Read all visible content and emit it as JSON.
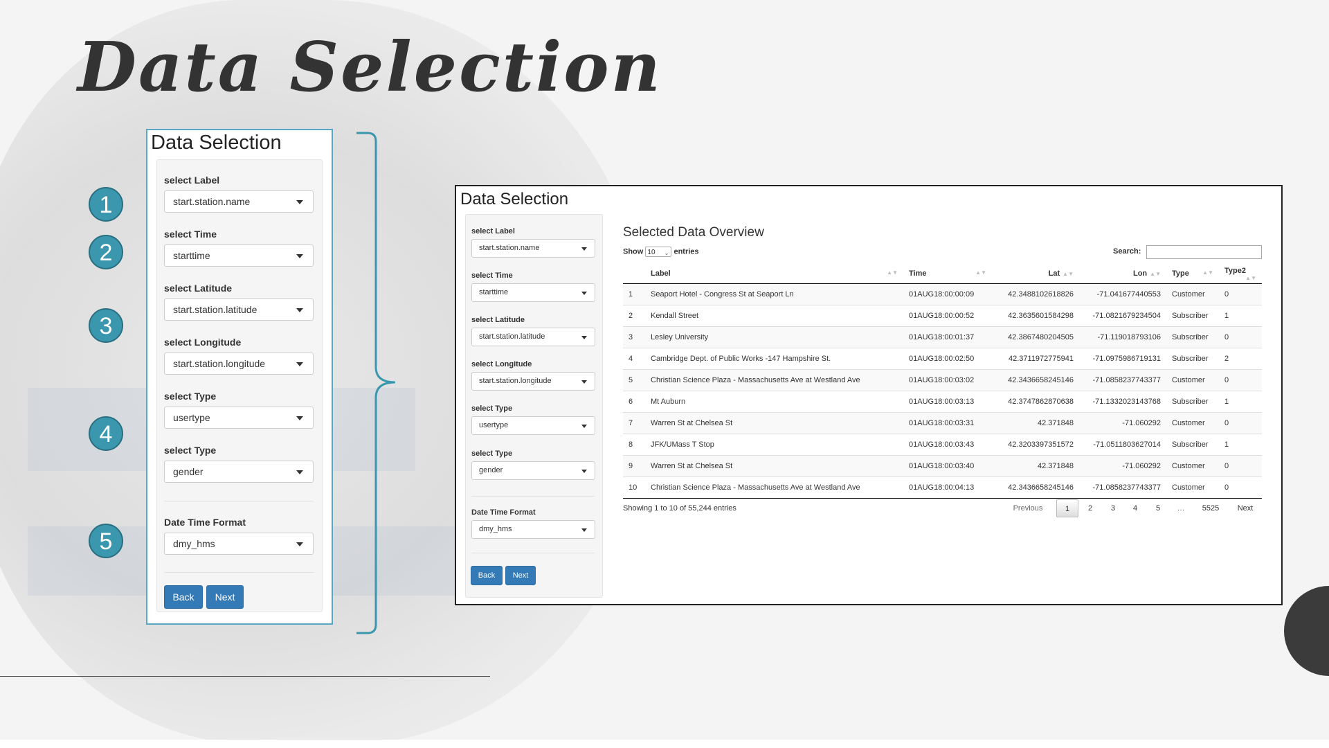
{
  "slide": {
    "title": "Data Selection"
  },
  "callouts": [
    "1",
    "2",
    "3",
    "4",
    "5"
  ],
  "left_panel": {
    "title": "Data Selection",
    "fields": [
      {
        "label": "select Label",
        "value": "start.station.name"
      },
      {
        "label": "select Time",
        "value": "starttime"
      },
      {
        "label": "select Latitude",
        "value": "start.station.latitude"
      },
      {
        "label": "select Longitude",
        "value": "start.station.longitude"
      },
      {
        "label": "select Type",
        "value": "usertype"
      },
      {
        "label": "select Type",
        "value": "gender"
      },
      {
        "label": "Date Time Format",
        "value": "dmy_hms"
      }
    ],
    "back_label": "Back",
    "next_label": "Next"
  },
  "right_panel": {
    "title": "Data Selection",
    "fields": [
      {
        "label": "select Label",
        "value": "start.station.name"
      },
      {
        "label": "select Time",
        "value": "starttime"
      },
      {
        "label": "select Latitude",
        "value": "start.station.latitude"
      },
      {
        "label": "select Longitude",
        "value": "start.station.longitude"
      },
      {
        "label": "select Type",
        "value": "usertype"
      },
      {
        "label": "select Type",
        "value": "gender"
      },
      {
        "label": "Date Time Format",
        "value": "dmy_hms"
      }
    ],
    "back_label": "Back",
    "next_label": "Next",
    "overview": {
      "title": "Selected Data Overview",
      "show_label": "Show",
      "entries_value": "10",
      "entries_label": "entries",
      "search_label": "Search:",
      "columns": [
        "",
        "Label",
        "Time",
        "Lat",
        "Lon",
        "Type",
        "Type2"
      ],
      "rows": [
        [
          "1",
          "Seaport Hotel - Congress St at Seaport Ln",
          "01AUG18:00:00:09",
          "42.3488102618826",
          "-71.041677440553",
          "Customer",
          "0"
        ],
        [
          "2",
          "Kendall Street",
          "01AUG18:00:00:52",
          "42.3635601584298",
          "-71.0821679234504",
          "Subscriber",
          "1"
        ],
        [
          "3",
          "Lesley University",
          "01AUG18:00:01:37",
          "42.3867480204505",
          "-71.119018793106",
          "Subscriber",
          "0"
        ],
        [
          "4",
          "Cambridge Dept. of Public Works -147 Hampshire St.",
          "01AUG18:00:02:50",
          "42.3711972775941",
          "-71.0975986719131",
          "Subscriber",
          "2"
        ],
        [
          "5",
          "Christian Science Plaza - Massachusetts Ave at Westland Ave",
          "01AUG18:00:03:02",
          "42.3436658245146",
          "-71.0858237743377",
          "Customer",
          "0"
        ],
        [
          "6",
          "Mt Auburn",
          "01AUG18:00:03:13",
          "42.3747862870638",
          "-71.1332023143768",
          "Subscriber",
          "1"
        ],
        [
          "7",
          "Warren St at Chelsea St",
          "01AUG18:00:03:31",
          "42.371848",
          "-71.060292",
          "Customer",
          "0"
        ],
        [
          "8",
          "JFK/UMass T Stop",
          "01AUG18:00:03:43",
          "42.3203397351572",
          "-71.0511803627014",
          "Subscriber",
          "1"
        ],
        [
          "9",
          "Warren St at Chelsea St",
          "01AUG18:00:03:40",
          "42.371848",
          "-71.060292",
          "Customer",
          "0"
        ],
        [
          "10",
          "Christian Science Plaza - Massachusetts Ave at Westland Ave",
          "01AUG18:00:04:13",
          "42.3436658245146",
          "-71.0858237743377",
          "Customer",
          "0"
        ]
      ],
      "info": "Showing 1 to 10 of 55,244 entries",
      "pagination": [
        "Previous",
        "1",
        "2",
        "3",
        "4",
        "5",
        "…",
        "5525",
        "Next"
      ]
    }
  }
}
